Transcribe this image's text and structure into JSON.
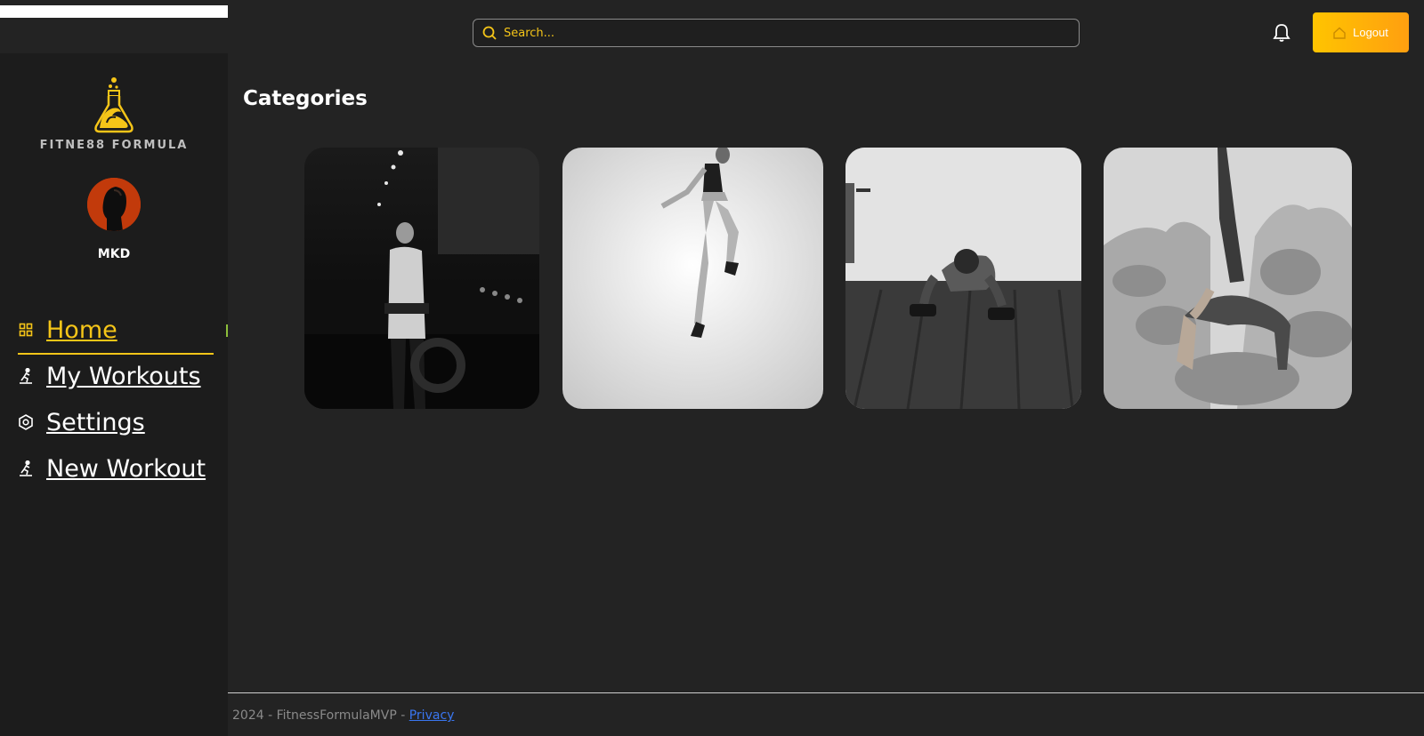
{
  "header": {
    "search_placeholder": "Search...",
    "logout_label": "Logout"
  },
  "sidebar": {
    "brand_name": "FITNE88 FORMULA",
    "username": "MKD",
    "items": [
      {
        "label": "Home",
        "icon": "grid-icon",
        "active": true
      },
      {
        "label": "My Workouts",
        "icon": "runner-icon"
      },
      {
        "label": "Settings",
        "icon": "hexagon-gear-icon"
      },
      {
        "label": "New Workout",
        "icon": "runner-icon"
      }
    ]
  },
  "main": {
    "title": "Categories",
    "categories": [
      {
        "name": "weightlifting"
      },
      {
        "name": "jump"
      },
      {
        "name": "push-up"
      },
      {
        "name": "yoga"
      }
    ]
  },
  "footer": {
    "text": "2024 - FitnessFormulaMVP - ",
    "privacy_label": "Privacy"
  },
  "colors": {
    "accent": "#f5c518",
    "background": "#232323",
    "sidebar": "#1c1c1c",
    "link": "#3a76f0"
  }
}
